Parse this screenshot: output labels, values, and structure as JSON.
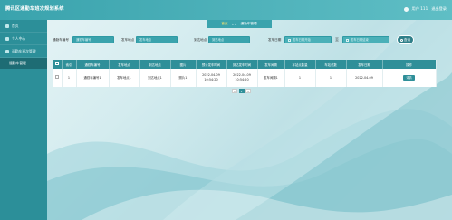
{
  "header": {
    "title": "腾讯区通勤车班次规划系统",
    "user_label": "用户 111",
    "logout_label": "退出登录"
  },
  "sidebar": {
    "items": [
      {
        "label": "首页",
        "icon": "home-icon"
      },
      {
        "label": "个人中心",
        "icon": "user-icon"
      },
      {
        "label": "通勤车班次管理",
        "icon": "bus-icon"
      }
    ],
    "sub_items": [
      {
        "label": "通勤车管理",
        "active": true
      }
    ]
  },
  "breadcrumb": {
    "home": "首页",
    "separator": ">>",
    "current": "通勤车管理"
  },
  "search": {
    "fields": [
      {
        "label": "通勤车编号",
        "placeholder": "通勤车编号"
      },
      {
        "label": "发车地点",
        "placeholder": "发车地点"
      },
      {
        "label": "到达地点",
        "placeholder": "到达地点"
      },
      {
        "label": "发车日期",
        "placeholder": "发车日期开始",
        "placeholder_end": "发车日期结束"
      }
    ],
    "date_separator": "至",
    "query_label": "查询"
  },
  "table": {
    "columns": [
      "",
      "索引",
      "通勤车编号",
      "发车地点",
      "到达地点",
      "图片",
      "预计发车时间",
      "到达发车时间",
      "发车间隔",
      "车站点数量",
      "车站总数",
      "发车日期",
      "操作"
    ],
    "rows": [
      {
        "index": "1",
        "bus_no": "通勤车编号1",
        "from": "发车地点1",
        "to": "到达地点1",
        "image": "照片1",
        "planned_time": "2022-04-09 10:54:20",
        "arrive_time": "2022-04-09 10:54:20",
        "interval": "发车间隔1",
        "station_count": "1",
        "total": "1",
        "date": "2022-04-09",
        "action": "详情"
      }
    ]
  },
  "pagination": {
    "prev": "<",
    "current": "1",
    "next": ">"
  },
  "colors": {
    "accent": "#2f8f99",
    "topbar": "#3aa3ad",
    "sidebar": "#2c8f99"
  }
}
